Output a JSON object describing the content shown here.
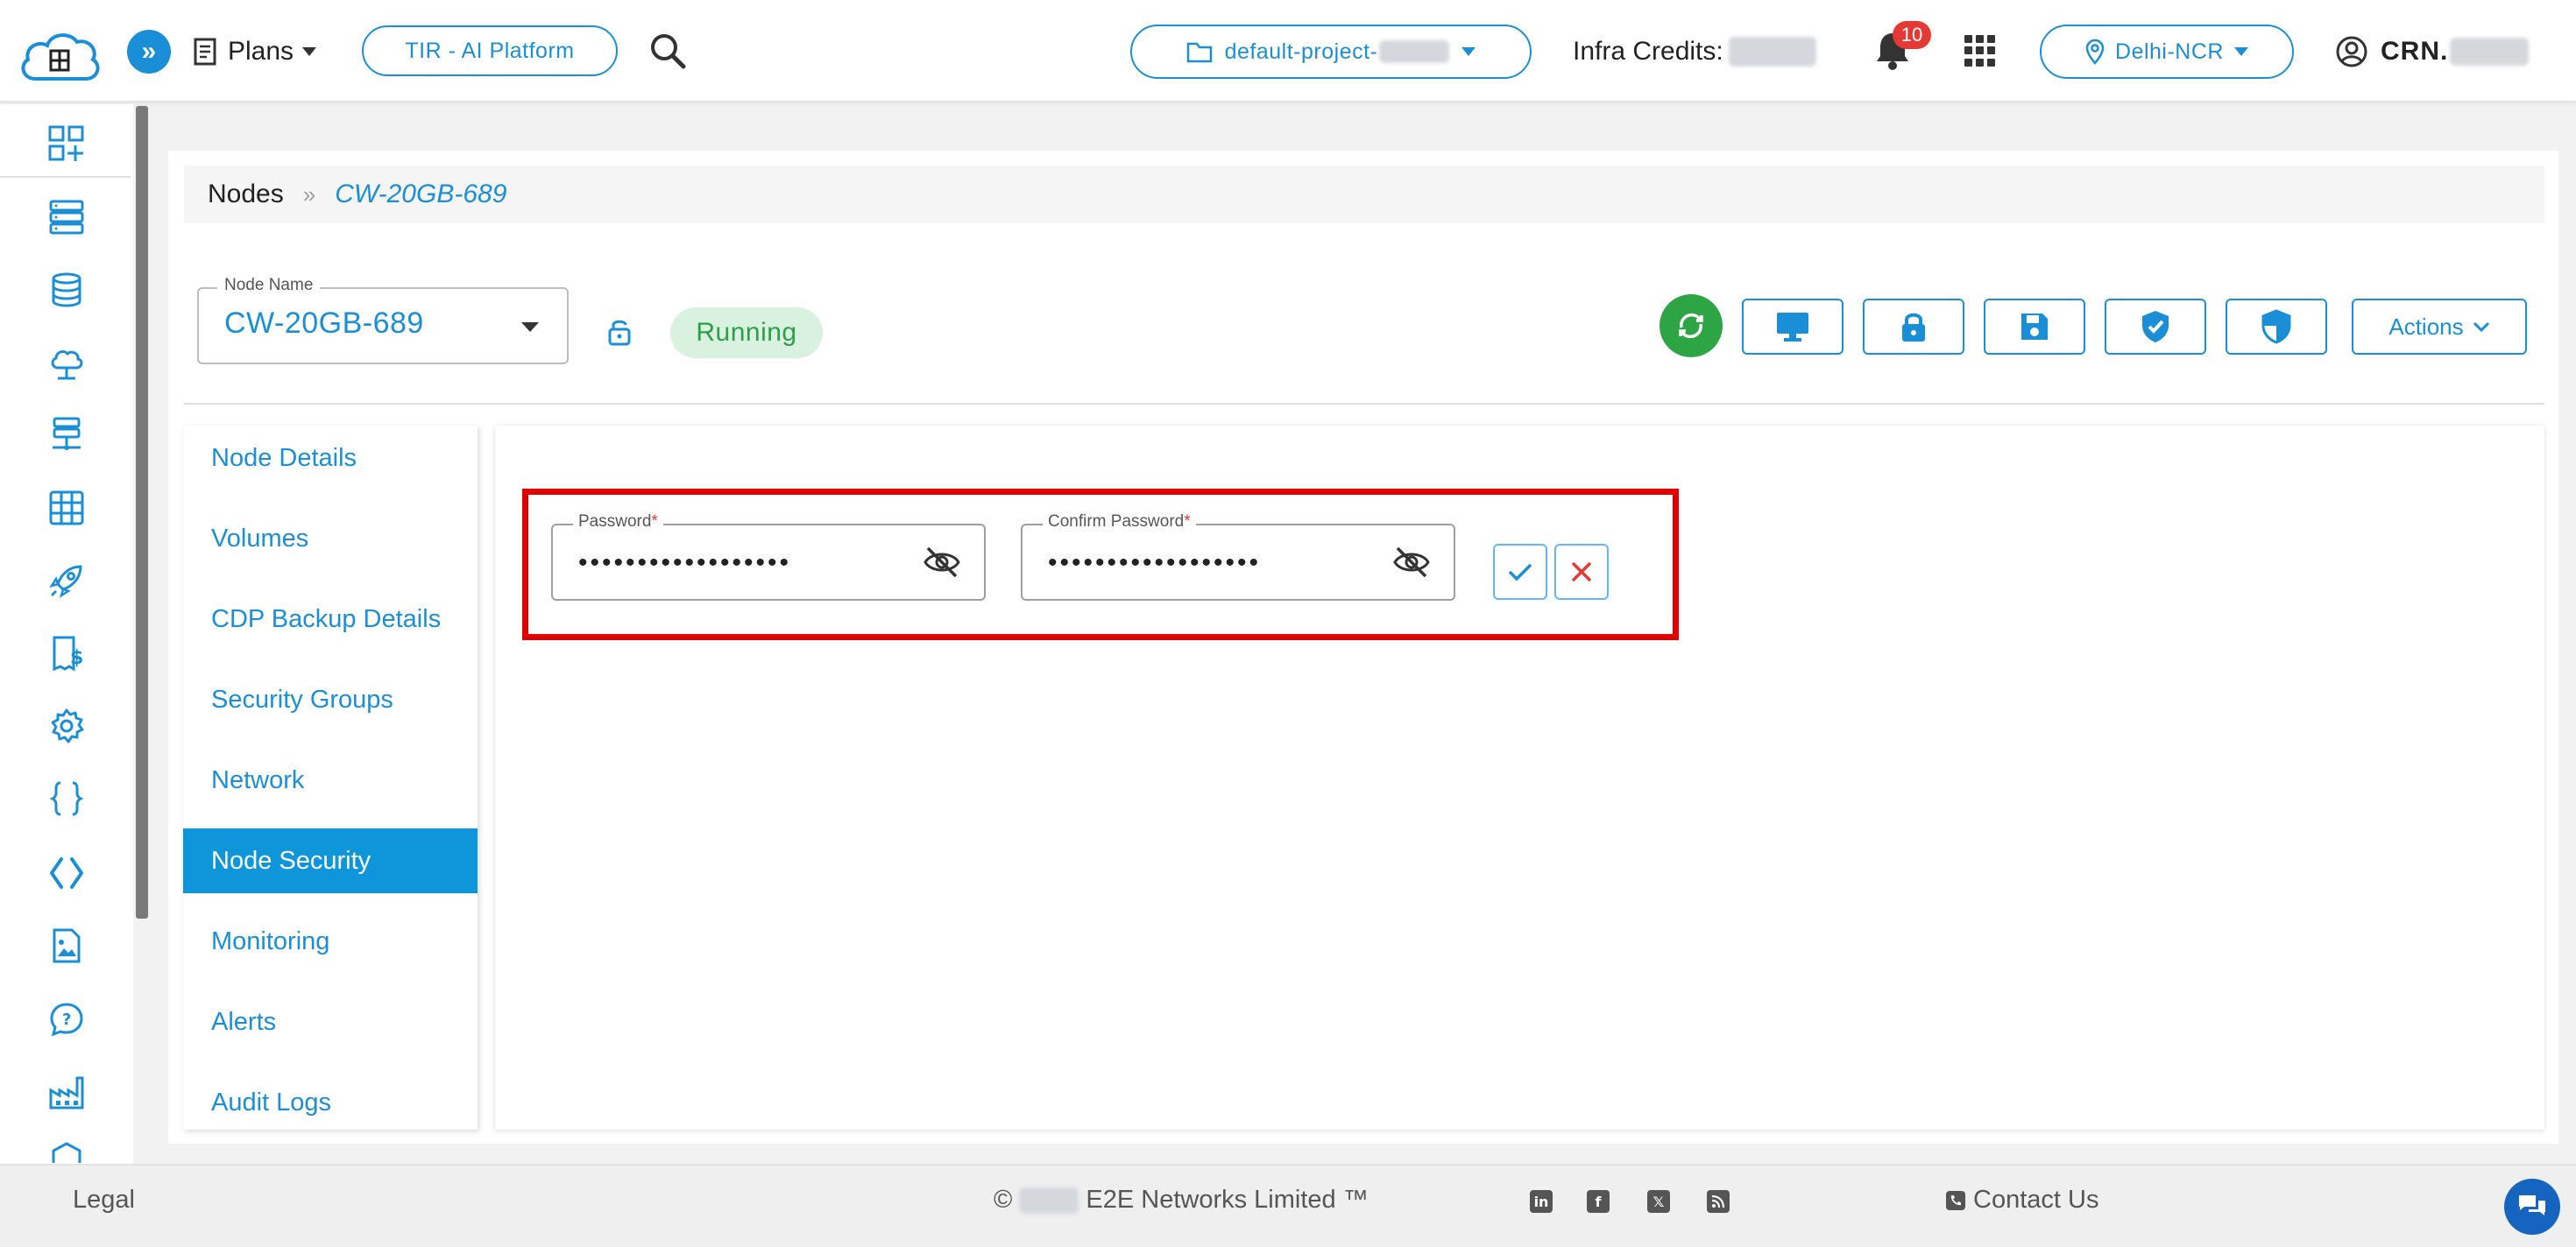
{
  "header": {
    "logo_alt": "E2E Cloud",
    "plans_label": "Plans",
    "tir_label": "TIR - AI Platform",
    "project_label": "default-project-",
    "credits_label": "Infra Credits: ",
    "notification_count": "10",
    "region_label": "Delhi-NCR",
    "user_label": "CRN. "
  },
  "sidebar": {
    "icons": [
      "dashboard-add-icon",
      "server-list-icon",
      "database-icon",
      "cloud-upload-icon",
      "network-server-icon",
      "grid-table-icon",
      "rocket-icon",
      "billing-icon",
      "settings-icon",
      "code-braces-icon",
      "code-tags-icon",
      "document-image-icon",
      "help-chat-icon",
      "factory-icon",
      "shield-icon"
    ]
  },
  "breadcrumb": {
    "root": "Nodes",
    "separator": "»",
    "current": "CW-20GB-689"
  },
  "node": {
    "field_label": "Node Name",
    "name": "CW-20GB-689",
    "status": "Running",
    "actions_label": "Actions"
  },
  "tabs": [
    {
      "label": "Node Details"
    },
    {
      "label": "Volumes"
    },
    {
      "label": "CDP Backup Details"
    },
    {
      "label": "Security Groups"
    },
    {
      "label": "Network"
    },
    {
      "label": "Node Security",
      "active": true
    },
    {
      "label": "Monitoring"
    },
    {
      "label": "Alerts"
    },
    {
      "label": "Audit Logs"
    }
  ],
  "password_form": {
    "password_label": "Password",
    "password_value": "••••••••••••••••••",
    "confirm_label": "Confirm Password",
    "confirm_value": "••••••••••••••••••",
    "required_mark": "*"
  },
  "footer": {
    "legal": "Legal",
    "copyright_symbol": "©",
    "company": "E2E Networks Limited ™",
    "contact": "Contact Us",
    "social": [
      "linkedin-icon",
      "facebook-icon",
      "x-icon",
      "rss-icon"
    ]
  },
  "colors": {
    "accent": "#1a8fd8",
    "status_green": "#2ea544",
    "highlight_red": "#e00000",
    "badge_red": "#e53935"
  }
}
